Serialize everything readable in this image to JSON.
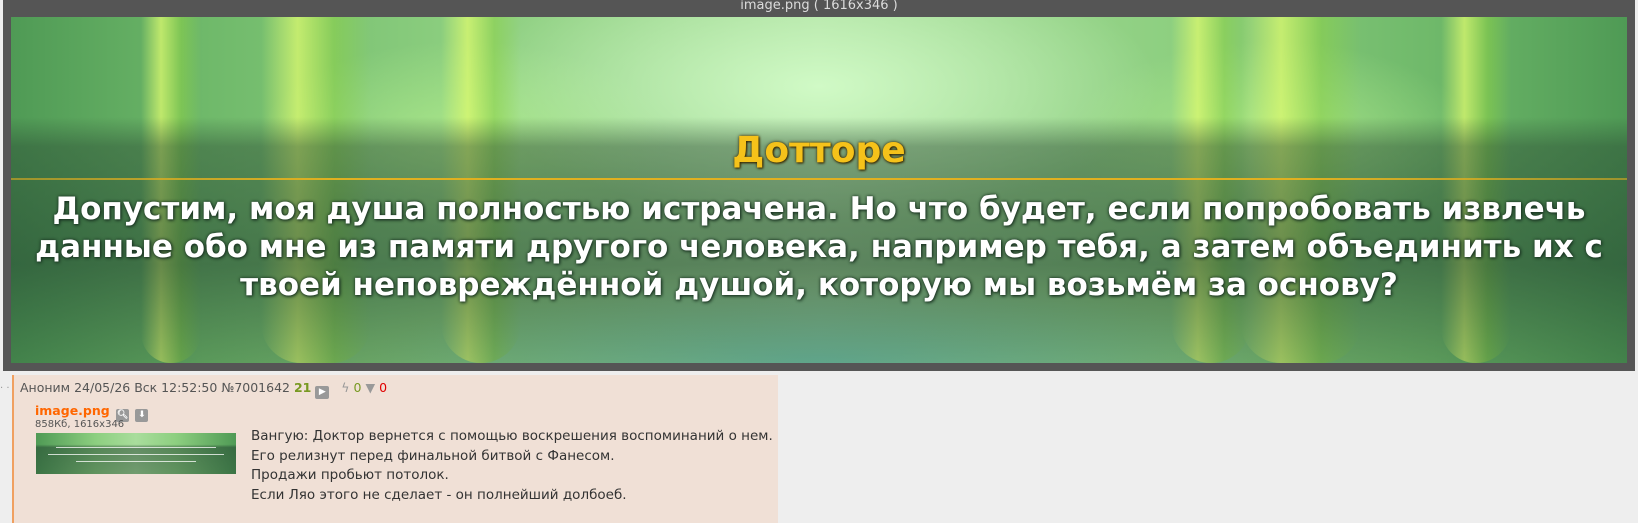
{
  "viewer": {
    "title": "image.png ( 1616x346 )",
    "image": {
      "speaker": "Дотторе",
      "dialogue_lines": [
        "Допустим, моя душа полностью истрачена. Но что будет, если попробовать извлечь",
        "данные обо мне из памяти другого человека, например тебя, а затем объединить их с",
        "твоей неповреждённой душой, которую мы возьмём за основу?"
      ]
    }
  },
  "post": {
    "author": "Аноним",
    "datetime": "24/05/26 Вск 12:52:50",
    "number": "№7001642",
    "replies": "21",
    "likes": "0",
    "dislikes": "0",
    "file": {
      "name": "image.png",
      "meta": "858Кб, 1616x346"
    },
    "text_lines": [
      "Вангую: Доктор вернется с помощью воскрешения воспоминаний о нем.",
      "Его релизнут перед финальной битвой с Фанесом.",
      "Продажи пробьют потолок.",
      "Если Ляо этого не сделает - он полнейший долбоеб."
    ]
  },
  "colors": {
    "post_bg": "#f0e0d6",
    "file_link": "#ff6600",
    "replies": "#789922",
    "dislike": "#e00000",
    "speaker": "#f5c21a"
  }
}
